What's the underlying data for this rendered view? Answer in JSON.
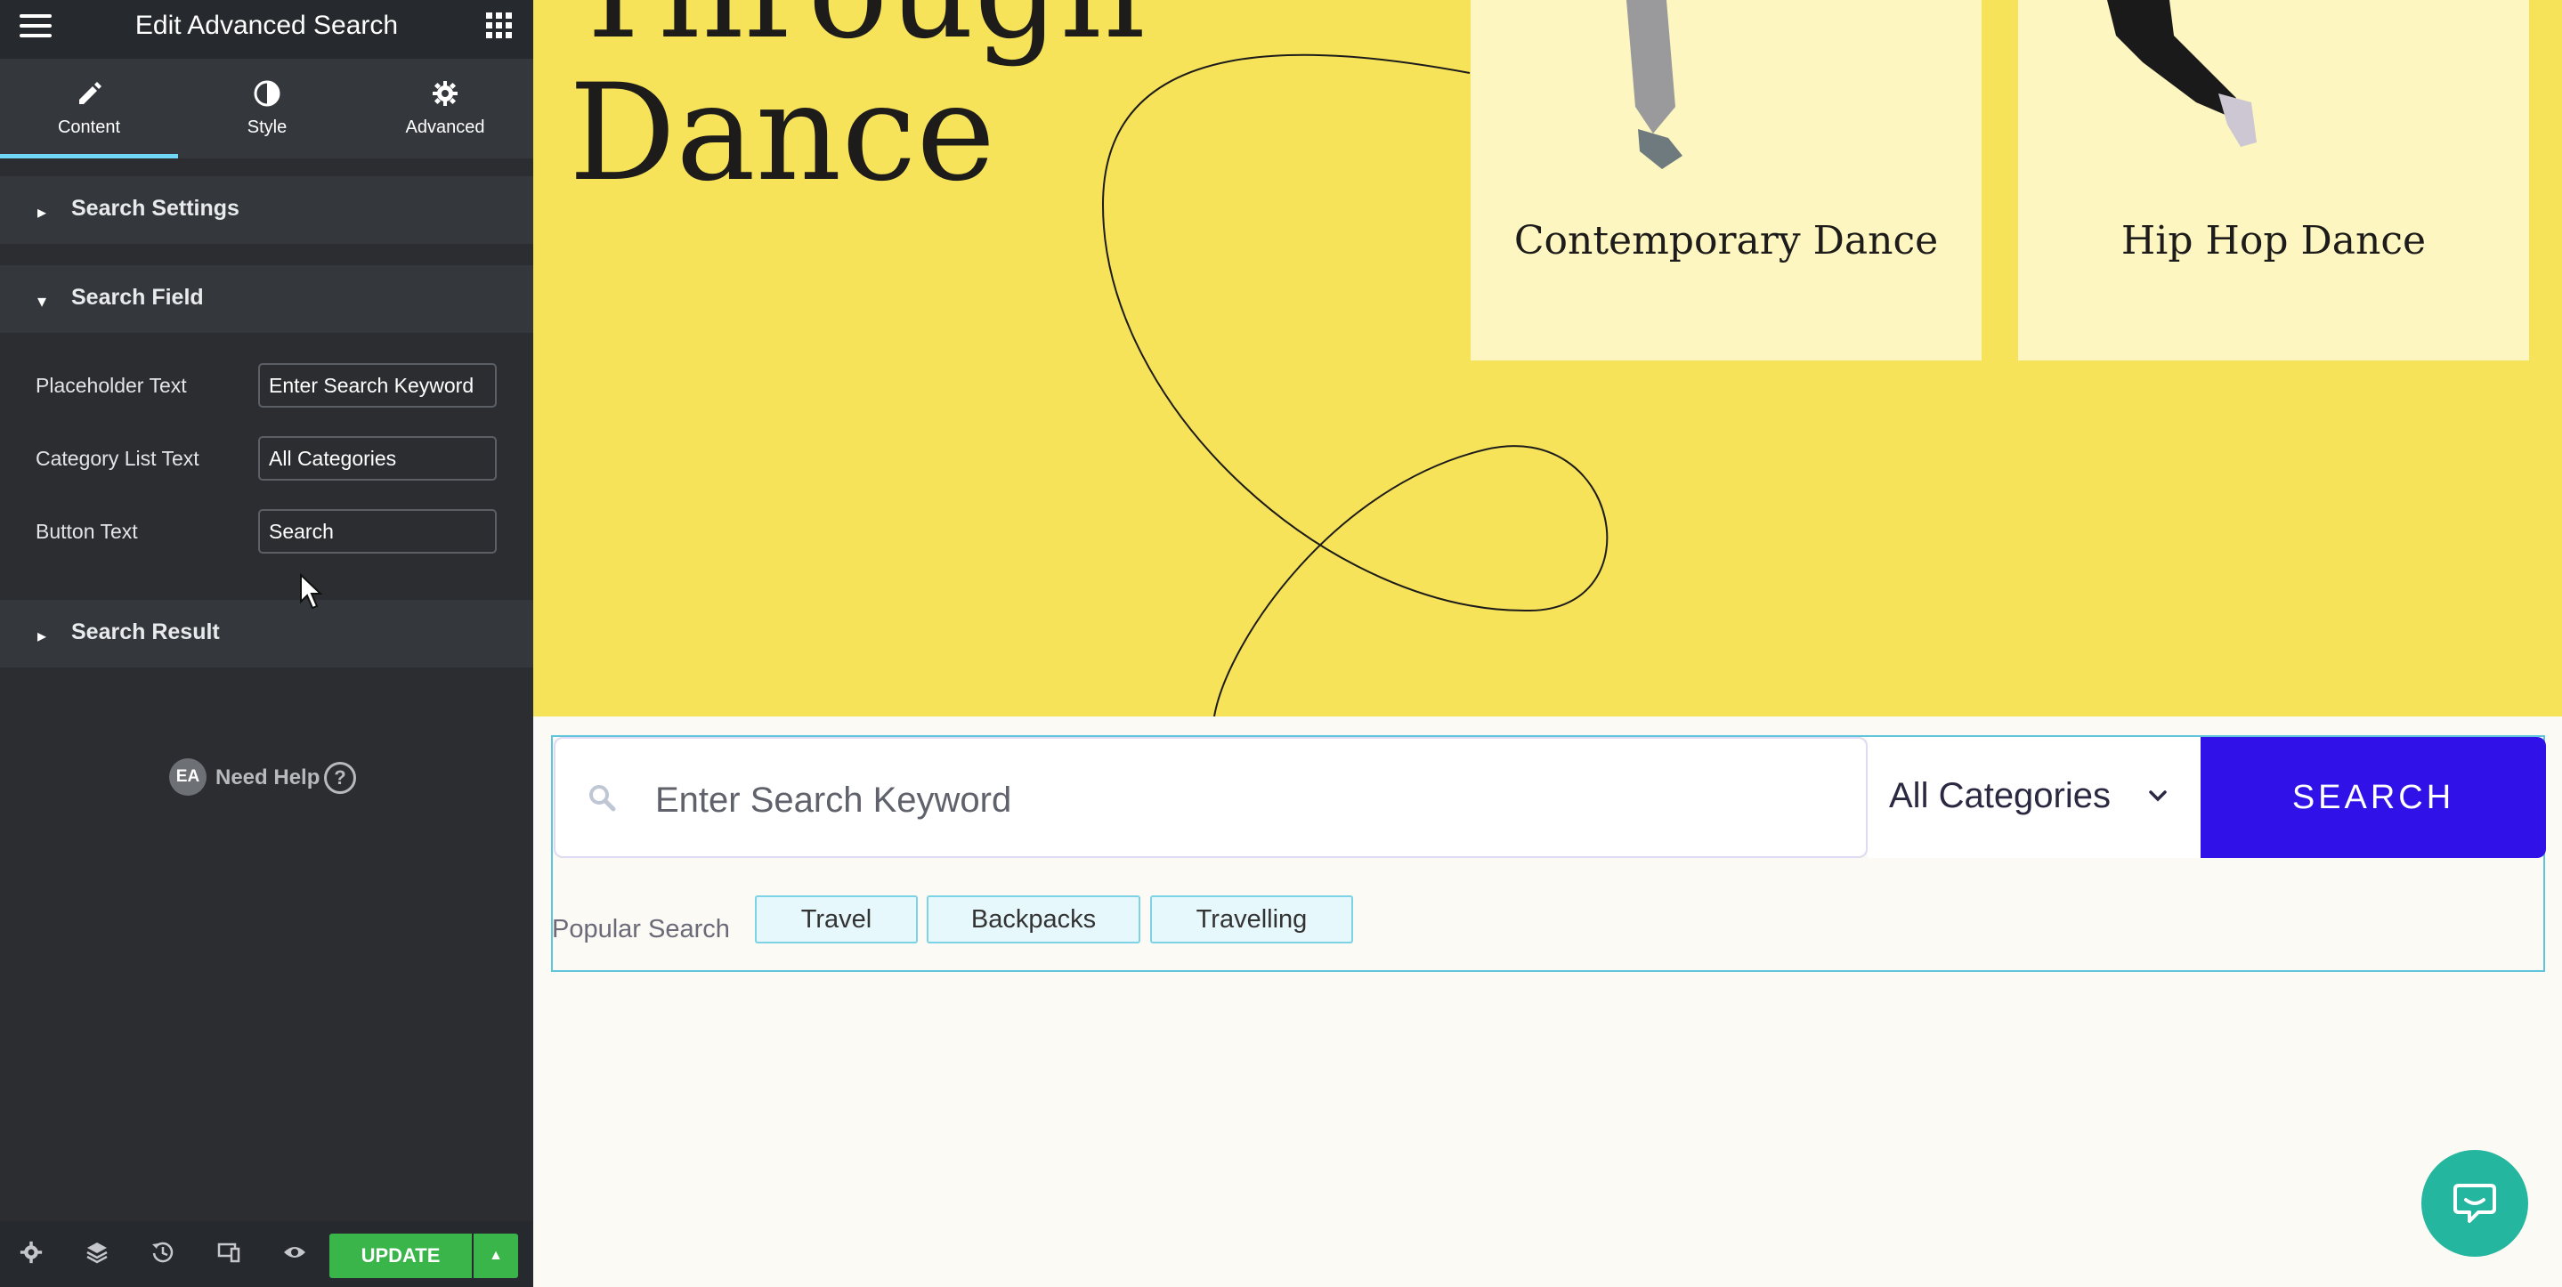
{
  "editor": {
    "title": "Edit Advanced Search",
    "tabs": [
      {
        "label": "Content",
        "icon": "pencil-icon"
      },
      {
        "label": "Style",
        "icon": "half-circle-icon"
      },
      {
        "label": "Advanced",
        "icon": "gear-icon"
      }
    ],
    "sections": {
      "search_settings": "Search Settings",
      "search_field": "Search Field",
      "search_result": "Search Result"
    },
    "fields": [
      {
        "label": "Placeholder Text",
        "value": "Enter Search Keyword"
      },
      {
        "label": "Category List Text",
        "value": "All Categories"
      },
      {
        "label": "Button Text",
        "value": "Search"
      }
    ],
    "help": {
      "badge": "EA",
      "text": "Need Help",
      "icon": "?"
    },
    "footer": {
      "update_label": "UPDATE"
    }
  },
  "preview": {
    "hero_title": "Through\nDance",
    "cards": [
      "Contemporary Dance",
      "Hip Hop Dance"
    ],
    "search": {
      "placeholder": "Enter Search Keyword",
      "category": "All Categories",
      "button": "SEARCH"
    },
    "popular": {
      "label": "Popular Search",
      "tags": [
        "Travel",
        "Backpacks",
        "Travelling"
      ]
    }
  },
  "colors": {
    "hero_bg": "#f6e35a",
    "card_bg": "#fdf6c1",
    "search_button": "#3012e8",
    "update_button": "#39b54a",
    "accent": "#71d7f7",
    "chat": "#25b69f"
  }
}
